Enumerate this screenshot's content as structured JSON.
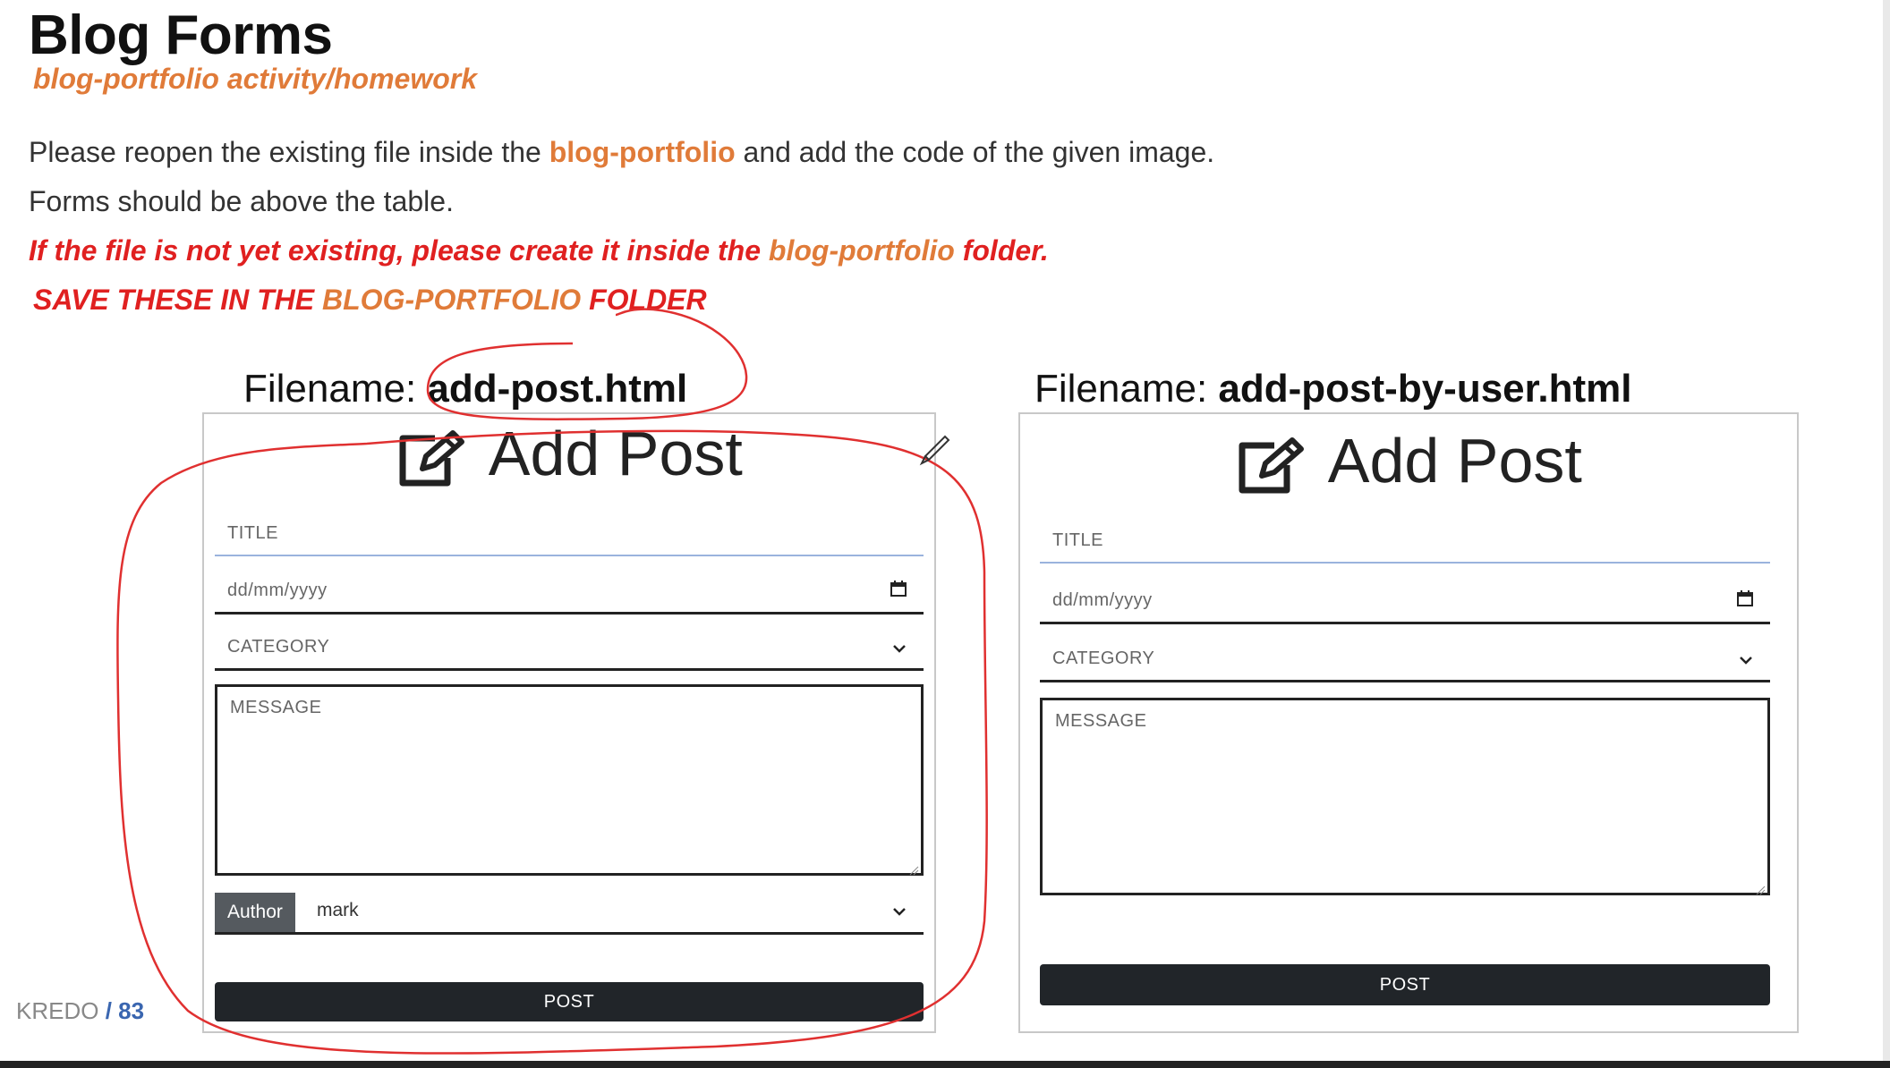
{
  "page": {
    "title": "Blog Forms",
    "subtitle": "blog-portfolio activity/homework",
    "line1": {
      "a": "Please reopen the existing file inside the ",
      "b": "blog-portfolio",
      "c": " and add the code of the given image."
    },
    "line2": "Forms should be above the table.",
    "line3": {
      "a": "If the file is not yet existing, please create it inside the ",
      "b": "blog-portfolio",
      "c": " folder."
    },
    "line4": {
      "a": "SAVE THESE IN THE ",
      "b": "BLOG-PORTFOLIO",
      "c": " FOLDER"
    }
  },
  "form1": {
    "filename_label": "Filename: ",
    "filename": "add-post.html",
    "heading": "Add Post",
    "title_placeholder": "TITLE",
    "date_placeholder": "dd/mm/yyyy",
    "category_placeholder": "CATEGORY",
    "message_placeholder": "MESSAGE",
    "author_label": "Author",
    "author_value": "mark",
    "post_button": "POST"
  },
  "form2": {
    "filename_label": "Filename: ",
    "filename": "add-post-by-user.html",
    "heading": "Add Post",
    "title_placeholder": "TITLE",
    "date_placeholder": "dd/mm/yyyy",
    "category_placeholder": "CATEGORY",
    "message_placeholder": "MESSAGE",
    "post_button": "POST"
  },
  "footer": {
    "brand": "KREDO",
    "sep": " / ",
    "page": "83"
  },
  "colors": {
    "accent_orange": "#e07b39",
    "warning_red": "#e02020",
    "annotation_red": "#e03030",
    "button_dark": "#212529"
  },
  "icons": [
    "edit-icon",
    "calendar-icon",
    "chevron-down-icon",
    "pencil-cursor-icon"
  ]
}
